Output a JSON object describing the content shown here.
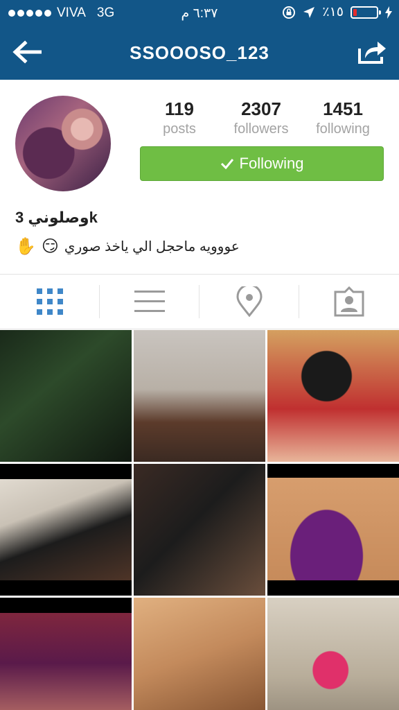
{
  "status_bar": {
    "carrier": "VIVA",
    "network": "3G",
    "time": "٦:٣٧ م",
    "battery_percent": "٪١٥",
    "battery_level": 0.15,
    "battery_color": "#e52b2b"
  },
  "header": {
    "title": "SSOOOSO_123",
    "bg_color": "#125688",
    "back_icon": "back-arrow-icon",
    "share_icon": "share-icon"
  },
  "profile": {
    "stats": [
      {
        "value": "119",
        "label": "posts"
      },
      {
        "value": "2307",
        "label": "followers"
      },
      {
        "value": "1451",
        "label": "following"
      }
    ],
    "follow_button": {
      "label": "Following",
      "color": "#6fbe44",
      "icon": "checkmark-icon"
    },
    "name": "وصلوني 3k",
    "bio": {
      "emoji_hand": "✋",
      "emoji_face": "😏",
      "text": "عووويه ماحجل الي ياخذ صوري"
    }
  },
  "tabs": [
    {
      "name": "grid-view",
      "icon": "grid-icon",
      "active": true
    },
    {
      "name": "list-view",
      "icon": "list-icon",
      "active": false
    },
    {
      "name": "map-view",
      "icon": "location-pin-icon",
      "active": false
    },
    {
      "name": "tagged-photos",
      "icon": "tagged-person-icon",
      "active": false
    }
  ],
  "grid": {
    "photo_count": 9
  }
}
